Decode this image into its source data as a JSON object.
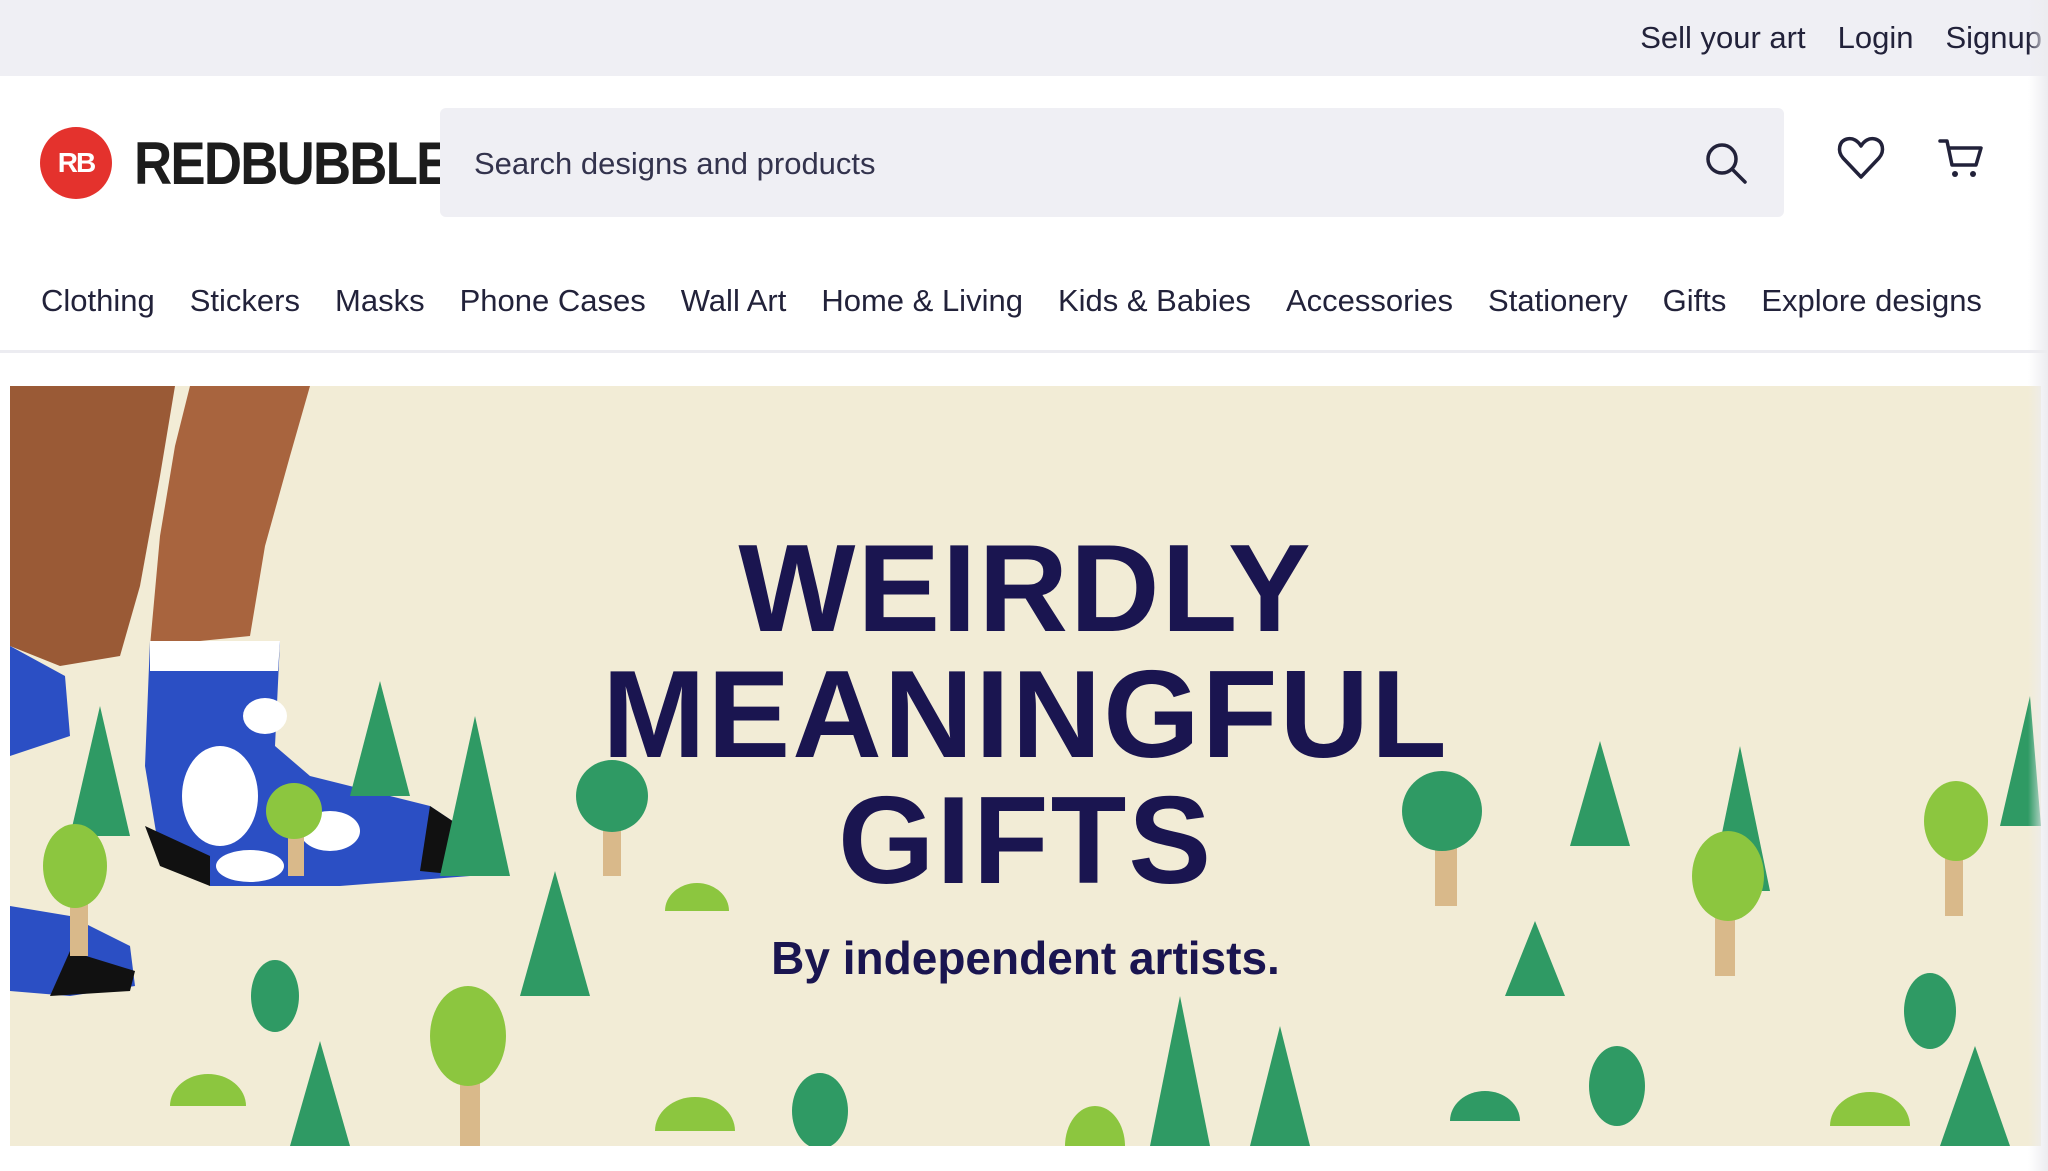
{
  "topbar": {
    "links": [
      "Sell your art",
      "Login",
      "Signup"
    ]
  },
  "header": {
    "logo_mark": "RB",
    "logo_text": "REDBUBBLE",
    "search": {
      "placeholder": "Search designs and products"
    }
  },
  "nav": {
    "items": [
      "Clothing",
      "Stickers",
      "Masks",
      "Phone Cases",
      "Wall Art",
      "Home & Living",
      "Kids & Babies",
      "Accessories",
      "Stationery",
      "Gifts",
      "Explore designs"
    ]
  },
  "hero": {
    "line1": "WEIRDLY",
    "line2": "MEANINGFUL",
    "line3": "GIFTS",
    "subtitle": "By independent artists."
  },
  "colors": {
    "brand_red": "#e4322d",
    "hero_text": "#1a1550",
    "hero_bg": "#f2ecd6",
    "tree_green": "#2f9a64",
    "lime": "#8cc63f",
    "sock_blue": "#2b4fc4"
  },
  "icons": [
    "search-icon",
    "heart-icon",
    "cart-icon"
  ]
}
